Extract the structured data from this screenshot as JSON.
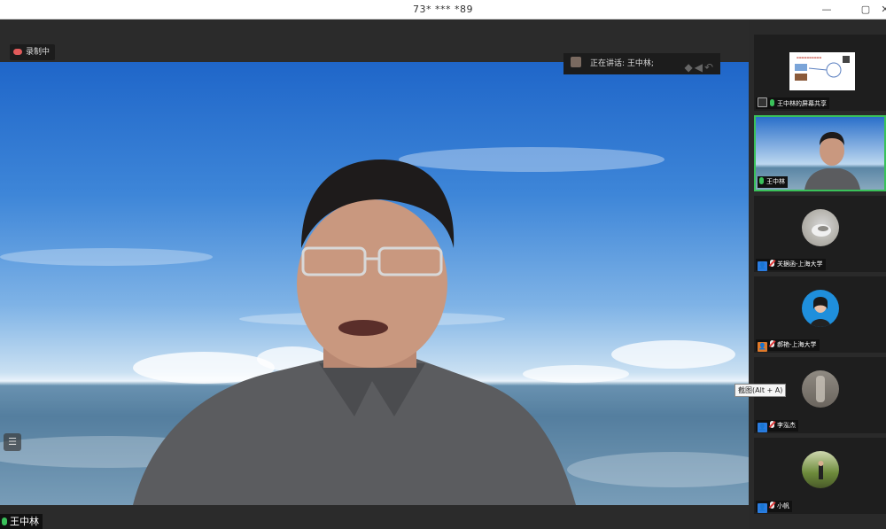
{
  "window": {
    "title": "73* *** *89",
    "minimize": "—",
    "maximize": "▢",
    "close": "✕"
  },
  "main": {
    "recording_label": "录制中",
    "speaking_label": "正在讲话: 王中林;",
    "speaker_name": "王中林",
    "nav_glyphs": "◆◀↶",
    "side_toggle_glyph": "☰"
  },
  "panel": {
    "tiles": [
      {
        "label": "王中林的屏幕共享",
        "kind": "screen-share"
      },
      {
        "label": "王中林",
        "kind": "video",
        "active": true
      },
      {
        "label": "关据函-上海大学",
        "kind": "avatar"
      },
      {
        "label": "郝艳-上海大学",
        "kind": "avatar"
      },
      {
        "label": "李泓杰",
        "kind": "avatar"
      },
      {
        "label": "小帆",
        "kind": "avatar"
      }
    ]
  },
  "tooltip": "截图(Alt + A)",
  "colors": {
    "accent_green": "#3ac15a",
    "participant_blue": "#2a7ce0",
    "participant_orange": "#e07a2a"
  }
}
